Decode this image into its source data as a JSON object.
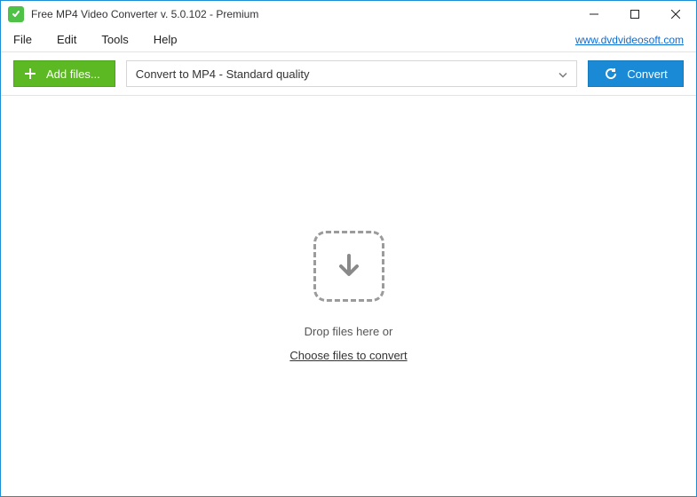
{
  "window": {
    "title": "Free MP4 Video Converter v. 5.0.102 - Premium"
  },
  "menu": {
    "file": "File",
    "edit": "Edit",
    "tools": "Tools",
    "help": "Help",
    "site_link": "www.dvdvideosoft.com"
  },
  "toolbar": {
    "add_files": "Add files...",
    "format_selected": "Convert to MP4 - Standard quality",
    "convert": "Convert"
  },
  "dropzone": {
    "hint": "Drop files here or",
    "choose": "Choose files to convert"
  }
}
